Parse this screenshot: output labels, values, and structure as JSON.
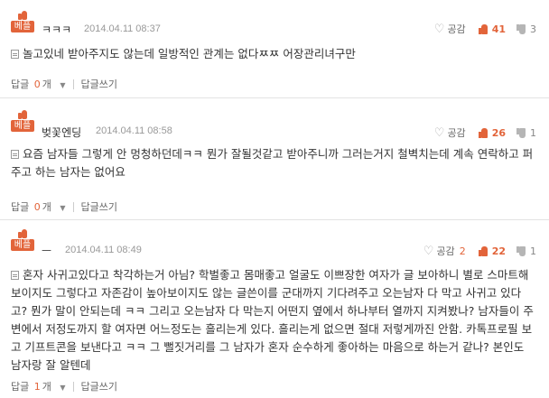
{
  "badge_label": "베플",
  "gong_label": "공감",
  "reply_label": "답글",
  "reply_unit": "개",
  "write_reply_label": "답글쓰기",
  "comments": [
    {
      "author": "ㅋㅋㅋ",
      "date": "2014.04.11 08:37",
      "gong_count": "",
      "up": "41",
      "down": "3",
      "text": "놀고있네 받아주지도 않는데 일방적인 관계는 없다ㅉㅉ 어장관리녀구만",
      "reply_count": "0"
    },
    {
      "author": "벚꽃엔딩",
      "date": "2014.04.11 08:58",
      "gong_count": "",
      "up": "26",
      "down": "1",
      "text": "요즘 남자들 그렇게 안 멍청하던데ㅋㅋ 뭔가 잘될것같고 받아주니까 그러는거지 철벽치는데 계속 연락하고 퍼주고 하는 남자는 없어요",
      "reply_count": "0"
    },
    {
      "author": "ㅡ",
      "date": "2014.04.11 08:49",
      "gong_count": "2",
      "up": "22",
      "down": "1",
      "text": "혼자 사귀고있다고 착각하는거 아님? 학벌좋고 몸매좋고 얼굴도 이쁘장한 여자가 글 보아하니 별로 스마트해보이지도 그렇다고 자존감이 높아보이지도 않는 글쓴이를 군대까지 기다려주고 오는남자 다 막고 사귀고 있다고? 뭔가 말이 안되는데 ㅋㅋ 그리고 오는남자 다 막는지 어떤지 옆에서 하나부터 열까지 지켜봤나? 남자들이 주변에서 저정도까지 할 여자면 어느정도는 흘리는게 있다. 흘리는게 없으면 절대 저렇게까진 안함. 카톡프로필 보고 기프트콘을 보낸다고 ㅋㅋ 그 뻘짓거리를 그 남자가 혼자 순수하게 좋아하는 마음으로 하는거 같나? 본인도 남자랑 잘 알텐데",
      "reply_count": "1"
    }
  ]
}
